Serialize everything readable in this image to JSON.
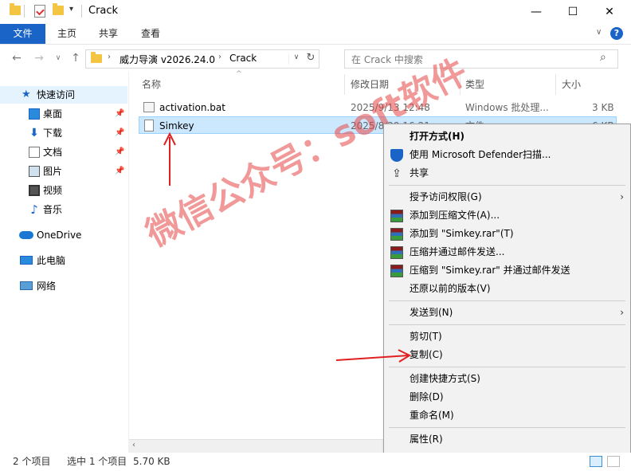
{
  "window": {
    "title": "Crack"
  },
  "ribbon": {
    "tabs": [
      "文件",
      "主页",
      "共享",
      "查看"
    ]
  },
  "address": {
    "path": [
      "威力导演 v2026.24.0",
      "Crack"
    ]
  },
  "search": {
    "placeholder": "在 Crack 中搜索"
  },
  "nav": {
    "quick_access": "快速访问",
    "items": [
      "桌面",
      "下载",
      "文档",
      "图片",
      "视频",
      "音乐"
    ],
    "onedrive": "OneDrive",
    "this_pc": "此电脑",
    "network": "网络"
  },
  "columns": [
    "名称",
    "修改日期",
    "类型",
    "大小"
  ],
  "files": [
    {
      "name": "activation.bat",
      "date": "2025/9/13 12:48",
      "type": "Windows 批处理...",
      "size": "3 KB"
    },
    {
      "name": "Simkey",
      "date": "2025/8/29 16:21",
      "type": "文件",
      "size": "6 KB"
    }
  ],
  "context_menu": {
    "open_with": "打开方式(H)",
    "defender": "使用 Microsoft Defender扫描...",
    "share": "共享",
    "grant_access": "授予访问权限(G)",
    "add_archive": "添加到压缩文件(A)...",
    "add_to_rar": "添加到 \"Simkey.rar\"(T)",
    "compress_email": "压缩并通过邮件发送...",
    "compress_rar_email": "压缩到 \"Simkey.rar\" 并通过邮件发送",
    "restore": "还原以前的版本(V)",
    "send_to": "发送到(N)",
    "cut": "剪切(T)",
    "copy": "复制(C)",
    "create_shortcut": "创建快捷方式(S)",
    "delete": "删除(D)",
    "rename": "重命名(M)",
    "properties": "属性(R)"
  },
  "status": {
    "items": "2 个项目",
    "selected": "选中 1 个项目",
    "size": "5.70 KB"
  },
  "watermark": "微信公众号：soft软件",
  "colors": {
    "accent": "#1a64c8",
    "selection": "#cce8ff",
    "arrow": "#e02020"
  }
}
